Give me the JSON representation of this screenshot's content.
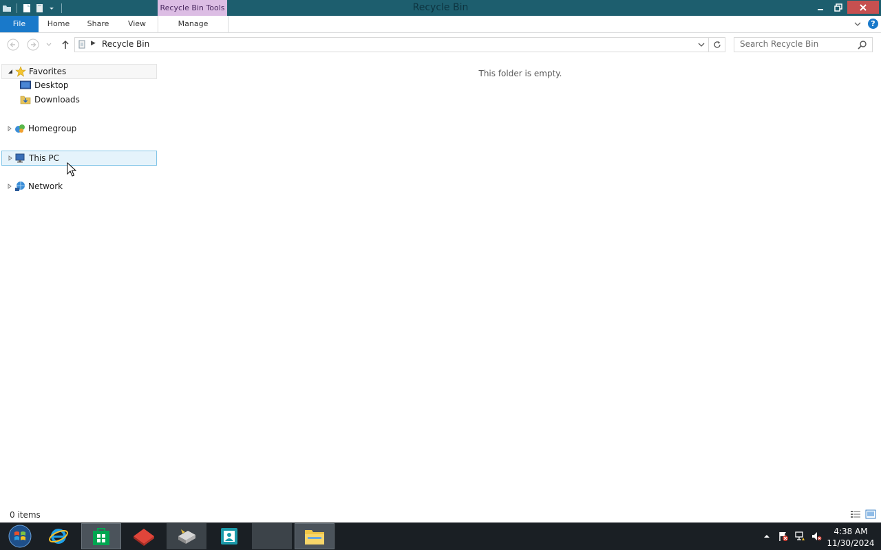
{
  "window": {
    "title": "Recycle Bin",
    "contextual_tab_group": "Recycle Bin Tools",
    "controls": [
      "minimize",
      "restore",
      "close"
    ]
  },
  "quick_access_toolbar": {
    "icons": [
      "folder-app-icon",
      "properties-icon",
      "new-folder-icon",
      "customize-dropdown-icon"
    ]
  },
  "ribbon": {
    "tabs": [
      {
        "label": "File",
        "active": true
      },
      {
        "label": "Home"
      },
      {
        "label": "Share"
      },
      {
        "label": "View"
      },
      {
        "label": "Manage"
      }
    ],
    "help_label": "?"
  },
  "address_bar": {
    "path": "Recycle Bin",
    "search_placeholder": "Search Recycle Bin"
  },
  "navigation_pane": {
    "favorites": {
      "label": "Favorites",
      "children": [
        {
          "label": "Desktop"
        },
        {
          "label": "Downloads"
        }
      ]
    },
    "homegroup": {
      "label": "Homegroup"
    },
    "this_pc": {
      "label": "This PC",
      "selected": true
    },
    "network": {
      "label": "Network"
    }
  },
  "content": {
    "empty_message": "This folder is empty."
  },
  "status_bar": {
    "items_count": "0 items"
  },
  "taskbar": {
    "apps": [
      "start",
      "internet-explorer",
      "store",
      "app-red",
      "network-drive",
      "contact",
      "blank-window",
      "file-explorer"
    ],
    "clock": {
      "time": "4:38 AM",
      "date": "11/30/2024"
    }
  },
  "colors": {
    "titlebar": "#1d5e6e",
    "file_tab": "#1979ca",
    "contextual_tab": "#dcbde4",
    "selection_bg": "#e5f3fb",
    "selection_border": "#84c6e8",
    "taskbar": "#1a1f24",
    "close_button": "#c75050"
  }
}
